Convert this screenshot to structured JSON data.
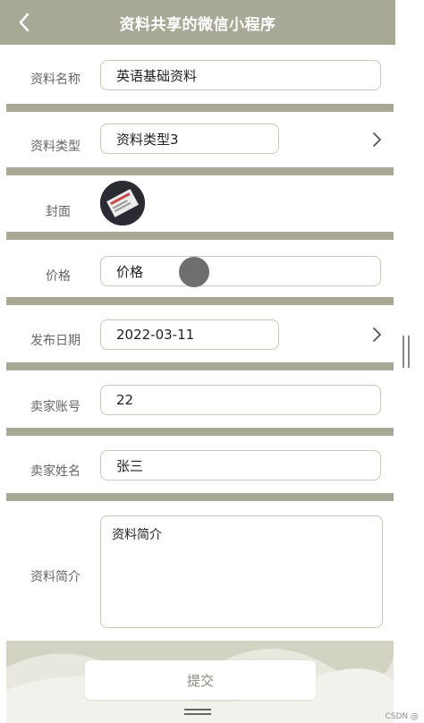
{
  "header": {
    "title": "资料共享的微信小程序",
    "back_icon": "chevron-left-icon"
  },
  "form": {
    "name_label": "资料名称",
    "name_value": "英语基础资料",
    "type_label": "资料类型",
    "type_value": "资料类型3",
    "cover_label": "封面",
    "price_label": "价格",
    "price_value": "价格",
    "date_label": "发布日期",
    "date_value": "2022-03-11",
    "seller_account_label": "卖家账号",
    "seller_account_value": "22",
    "seller_name_label": "卖家姓名",
    "seller_name_value": "张三",
    "intro_label": "资料简介",
    "intro_value": "资料简介"
  },
  "submit_label": "提交",
  "watermark": "CSDN @",
  "colors": {
    "accent": "#a8a896",
    "footer": "#d9d9cc",
    "border": "#c8c8b8"
  }
}
